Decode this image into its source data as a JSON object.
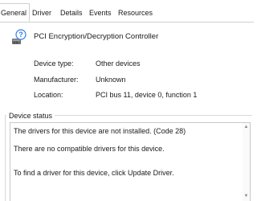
{
  "tabs": [
    {
      "label": "General",
      "active": true
    },
    {
      "label": "Driver",
      "active": false
    },
    {
      "label": "Details",
      "active": false
    },
    {
      "label": "Events",
      "active": false
    },
    {
      "label": "Resources",
      "active": false
    }
  ],
  "device": {
    "name": "PCI Encryption/Decryption Controller",
    "icon": "unknown-device-icon"
  },
  "properties": {
    "type_label": "Device type:",
    "type_value": "Other devices",
    "manufacturer_label": "Manufacturer:",
    "manufacturer_value": "Unknown",
    "location_label": "Location:",
    "location_value": "PCI bus 11, device 0, function 1"
  },
  "status": {
    "legend": "Device status",
    "lines": [
      "The drivers for this device are not installed. (Code 28)",
      "There are no compatible drivers for this device.",
      "To find a driver for this device, click Update Driver."
    ]
  },
  "colors": {
    "accent": "#0067c0",
    "border": "#d0d0d0"
  }
}
